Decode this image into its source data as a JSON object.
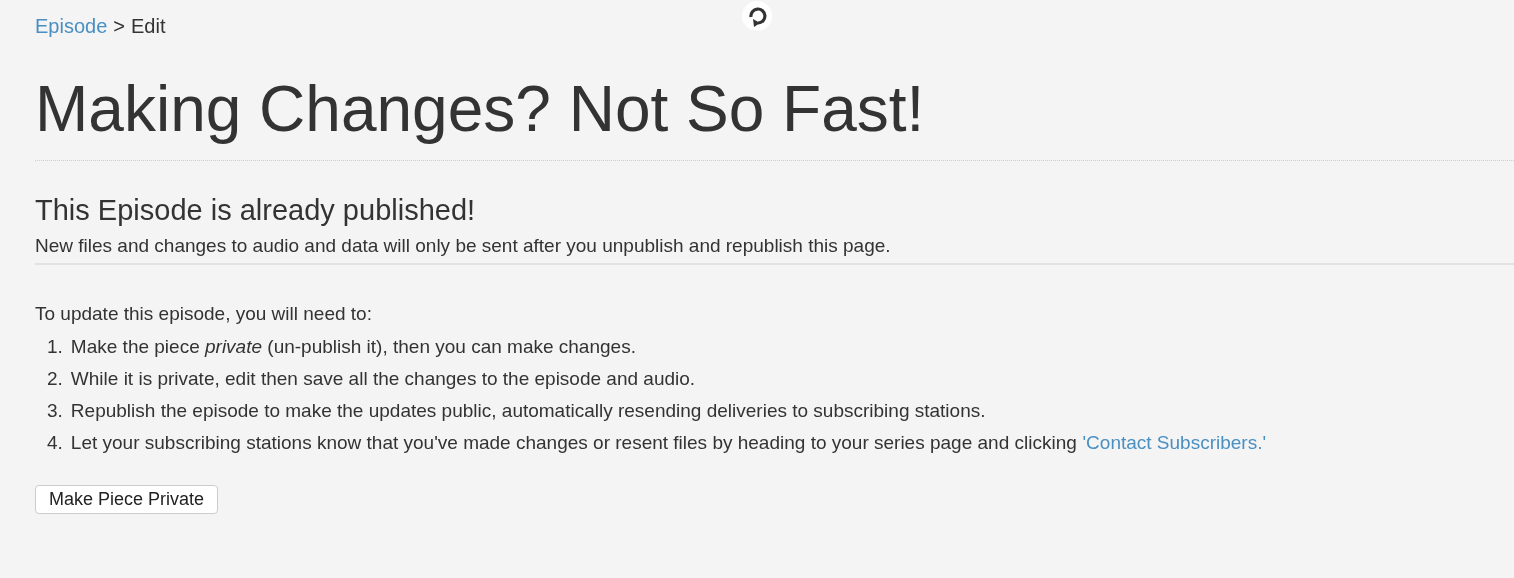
{
  "breadcrumb": {
    "link": "Episode",
    "separator": ">",
    "current": "Edit"
  },
  "title": "Making Changes? Not So Fast!",
  "notice": {
    "heading": "This Episode is already published!",
    "text": "New files and changes to audio and data will only be sent after you unpublish and republish this page."
  },
  "instructions": {
    "intro": "To update this episode, you will need to:",
    "steps": [
      {
        "number": "1.",
        "text": "Make the piece *private* (un-publish it), then you can make changes."
      },
      {
        "number": "2.",
        "text": "While it is private, edit then save all the changes to the episode and audio."
      },
      {
        "number": "3.",
        "text": "Republish the episode to make the updates public, automatically resending deliveries to subscribing stations."
      },
      {
        "number": "4.",
        "text": "Let your subscribing stations know that you've made changes or resent files by heading to your series page and clicking",
        "link": "'Contact Subscribers.'"
      }
    ]
  },
  "button": "Make Piece Private"
}
